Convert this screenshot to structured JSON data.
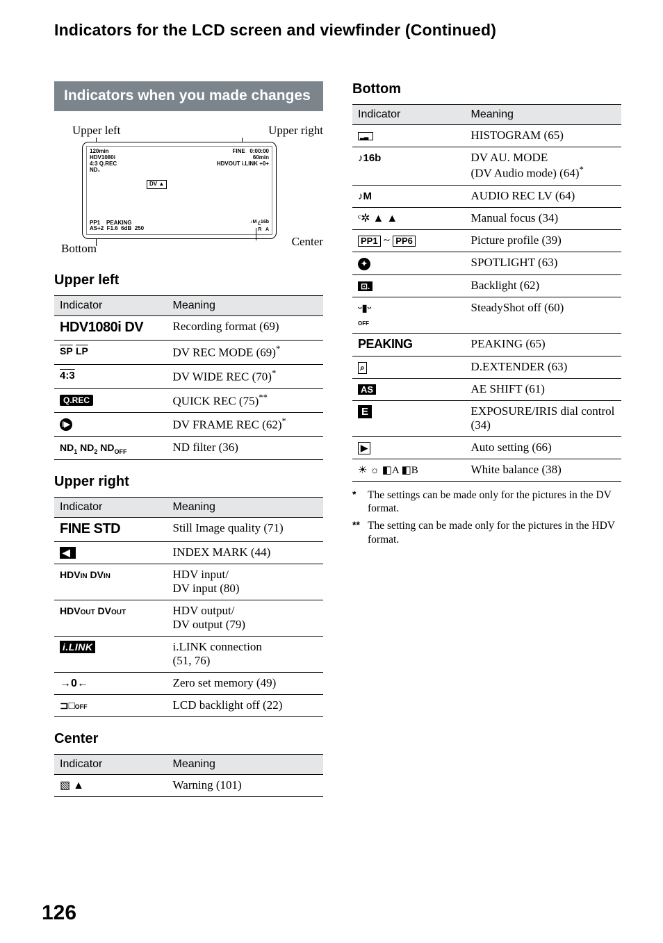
{
  "page_title": "Indicators for the LCD screen and viewfinder (Continued)",
  "page_number": "126",
  "banner": "Indicators when you made changes",
  "diagram": {
    "upper_left": "Upper left",
    "upper_right": "Upper right",
    "bottom": "Bottom",
    "center": "Center",
    "screen": {
      "tl": "120min\nHDV1080i\n4:3 Q.REC\nND₁",
      "tr": "FINE   0:00:00\n60min\nHDVOUT i.LINK +0+",
      "mid": "DV ▲",
      "bl": "PP1    PEAKING\nAS+2  F1.6  6dB  250",
      "br": "♪M ♪16b",
      "brr": "L\nR   A"
    }
  },
  "sections": {
    "upper_left": {
      "title": "Upper left",
      "header_ind": "Indicator",
      "header_mean": "Meaning",
      "rows": [
        {
          "ind_html": "<span class='ind-cond'>HDV1080i DV</span>",
          "mean": "Recording format (69)"
        },
        {
          "ind_html": "<span class='ind-sans overline' style='font-size:14px'>SP</span> <span class='ind-sans overline' style='font-size:14px'>LP</span>",
          "mean": "DV REC MODE (69)*"
        },
        {
          "ind_html": "<span class='ind-sans overline' style='font-size:15px'>4:3</span>",
          "mean": "DV WIDE REC (70)*"
        },
        {
          "ind_html": "<span class='ind-box'>Q.REC</span>",
          "mean": "QUICK REC (75)**"
        },
        {
          "ind_html": "<span class='circ'>I▶</span>",
          "mean": "DV FRAME REC (62)*"
        },
        {
          "ind_html": "<span class='ind-sans' style='font-size:14px'>ND<span class='small-sub'>1</span> ND<span class='small-sub'>2</span> ND<span class='small-sub'>OFF</span></span>",
          "mean": "ND filter (36)"
        }
      ]
    },
    "upper_right": {
      "title": "Upper right",
      "header_ind": "Indicator",
      "header_mean": "Meaning",
      "rows": [
        {
          "ind_html": "<span class='ind-cond'>FINE STD</span>",
          "mean": "Still Image quality (71)"
        },
        {
          "ind_html": "<span class='ind-box-sq'>◀&nbsp;</span>",
          "mean": "INDEX MARK (44)"
        },
        {
          "ind_html": "<span class='ind-sans' style='font-size:14px'>HDV<span style=\"font-size:10px\">IN</span> DV<span style=\"font-size:10px\">IN</span></span>",
          "mean": "HDV input/\nDV input (80)"
        },
        {
          "ind_html": "<span class='ind-sans' style='font-size:14px'>HDV<span style=\"font-size:10px\">OUT</span> DV<span style=\"font-size:10px\">OUT</span></span>",
          "mean": "HDV output/\nDV output (79)"
        },
        {
          "ind_html": "<span class='ilink'>i.LINK</span>",
          "mean": "i.LINK connection\n(51, 76)"
        },
        {
          "ind_html": "<span class='ind-sans' style='font-size:16px'>→0←</span>",
          "mean": "Zero set memory (49)"
        },
        {
          "ind_html": "<span class='ind-sans' style='font-size:15px'>⊐□<span style=\"font-size:9px\">OFF</span></span>",
          "mean": "LCD backlight off (22)"
        }
      ]
    },
    "center": {
      "title": "Center",
      "header_ind": "Indicator",
      "header_mean": "Meaning",
      "rows": [
        {
          "ind_html": "<span style='font-size:16px'>▧ ▲</span>",
          "mean": "Warning (101)"
        }
      ]
    },
    "bottom": {
      "title": "Bottom",
      "header_ind": "Indicator",
      "header_mean": "Meaning",
      "rows": [
        {
          "ind_html": "<span style='display:inline-block;border:1px solid #000;width:22px;height:12px;position:relative;top:2px;'><span style='position:absolute;left:2px;bottom:0;font-size:8px'>▂▃</span></span>",
          "mean": "HISTOGRAM (65)"
        },
        {
          "ind_html": "<span class='ind-sans' style='font-size:15px'>♪16b</span>",
          "mean": "DV AU. MODE\n(DV Audio mode) (64)*"
        },
        {
          "ind_html": "<span class='ind-sans' style='font-size:15px'>♪M</span>",
          "mean": "AUDIO REC LV (64)"
        },
        {
          "ind_html": "<span style='font-size:16px'>ᶜ✲ ▲ ▲</span>",
          "mean": "Manual focus (34)"
        },
        {
          "ind_html": "<span class='ind-outline'>PP1</span> ~ <span class='ind-outline'>PP6</span>",
          "mean": "Picture profile (39)"
        },
        {
          "ind_html": "<span class='circ'>✦</span>",
          "mean": "SPOTLIGHT (63)"
        },
        {
          "ind_html": "<span class='ind-box-sq' style='font-size:12px'>⊡.</span>",
          "mean": "Backlight (62)"
        },
        {
          "ind_html": "<span class='ind-sans' style='font-size:14px'>ᵕ▮ᵕ<br><span style=\"font-size:8px\">OFF</span></span>",
          "mean": "SteadyShot off (60)"
        },
        {
          "ind_html": "<span class='ind-cond' style='font-size:18px'>PEAKING</span>",
          "mean": "PEAKING (65)"
        },
        {
          "ind_html": "<span class='ind-sans' style='display:inline-block;border:1px solid #000;padding:0 2px;font-size:12px'>⌕</span>",
          "mean": "D.EXTENDER (63)"
        },
        {
          "ind_html": "<span class='ind-box-sq' style='font-size:13px'>AS</span>",
          "mean": "AE SHIFT (61)"
        },
        {
          "ind_html": "<span class='ind-box-sq' style='font-size:15px;padding:1px 5px'>E</span>",
          "mean": "EXPOSURE/IRIS dial control (34)"
        },
        {
          "ind_html": "<span class='ind-sans' style='display:inline-block;border:1.5px solid #000;padding:0 3px;font-size:13px'>▶</span>",
          "mean": "Auto setting (66)"
        },
        {
          "ind_html": "<span style='font-size:15px'>☀ ☼ ◧A ◧B</span>",
          "mean": "White balance (38)"
        }
      ]
    }
  },
  "footnotes": [
    {
      "mark": "*",
      "text": "The settings can be made only for the pictures in the DV format."
    },
    {
      "mark": "**",
      "text": "The setting can be made only for the pictures in the HDV format."
    }
  ]
}
